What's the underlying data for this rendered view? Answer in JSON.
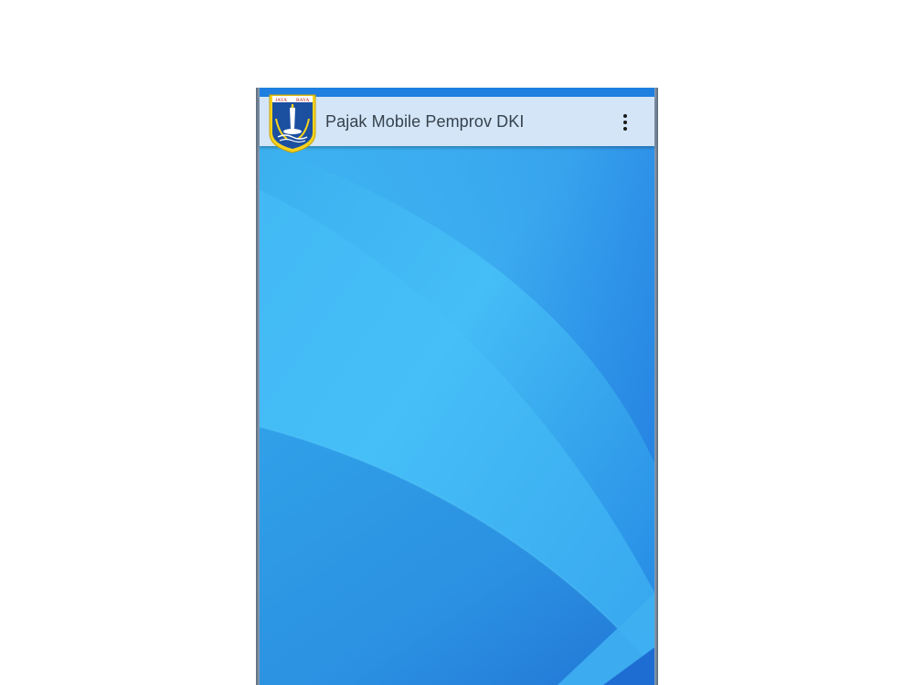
{
  "app": {
    "title": "Pajak Mobile Pemprov DKI",
    "logo_text_left": "JAYA",
    "logo_text_right": "RAYA"
  },
  "icons": {
    "logo": "jakarta-emblem-icon",
    "menu": "more-vertical-icon"
  },
  "colors": {
    "appbar_bg": "#d3e5f7",
    "wallpaper_light": "#4cc2f8",
    "wallpaper_dark": "#1d6fdc",
    "title_text": "#37424d"
  }
}
